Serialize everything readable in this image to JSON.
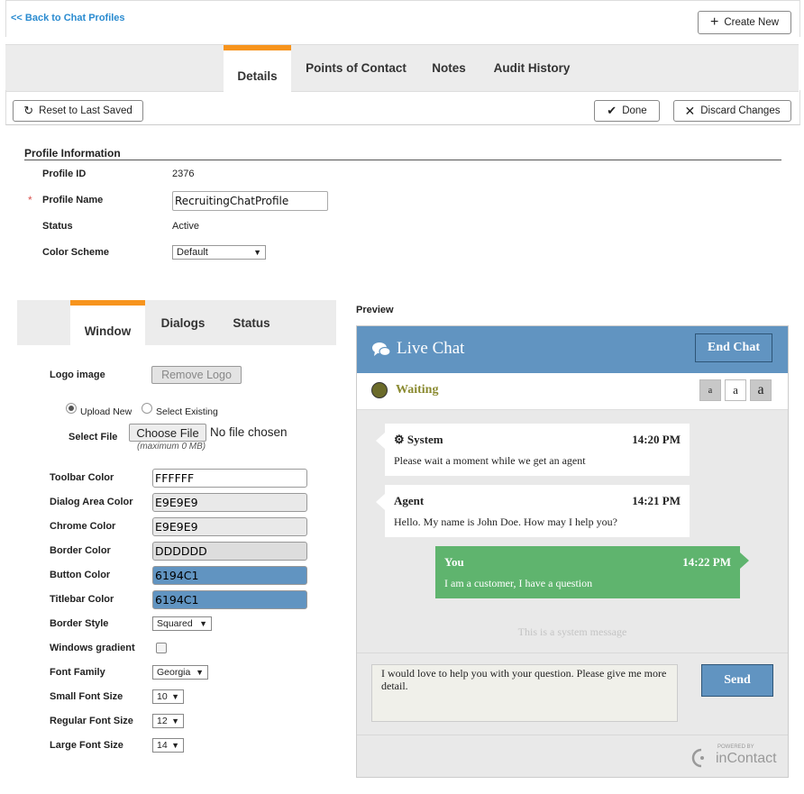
{
  "nav": {
    "back_label": "<< Back to Chat Profiles",
    "create_new_label": "Create New"
  },
  "tabs": [
    {
      "label": "Details",
      "active": true
    },
    {
      "label": "Points of Contact",
      "active": false
    },
    {
      "label": "Notes",
      "active": false
    },
    {
      "label": "Audit History",
      "active": false
    }
  ],
  "toolbar": {
    "reset_label": "Reset to Last Saved",
    "done_label": "Done",
    "discard_label": "Discard Changes"
  },
  "profile": {
    "section_title": "Profile Information",
    "id_label": "Profile ID",
    "id_value": "2376",
    "required_mark": "*",
    "name_label": "Profile Name",
    "name_value": "RecruitingChatProfile",
    "status_label": "Status",
    "status_value": "Active",
    "color_label": "Color Scheme",
    "color_value": "Default"
  },
  "subtabs": [
    {
      "label": "Window",
      "active": true
    },
    {
      "label": "Dialogs",
      "active": false
    },
    {
      "label": "Status",
      "active": false
    }
  ],
  "window_settings": {
    "logo_label": "Logo image",
    "remove_logo_label": "Remove Logo",
    "upload_new_label": "Upload New",
    "select_existing_label": "Select Existing",
    "select_file_label": "Select File",
    "choose_file_label": "Choose File",
    "no_file_label": "No file chosen",
    "max_size_note": "(maximum 0 MB)",
    "colors": [
      {
        "label": "Toolbar Color",
        "value": "FFFFFF",
        "bg": "#ffffff"
      },
      {
        "label": "Dialog Area Color",
        "value": "E9E9E9",
        "bg": "#e9e9e9"
      },
      {
        "label": "Chrome Color",
        "value": "E9E9E9",
        "bg": "#e9e9e9"
      },
      {
        "label": "Border Color",
        "value": "DDDDDD",
        "bg": "#dddddd"
      },
      {
        "label": "Button Color",
        "value": "6194C1",
        "bg": "#6194c1"
      },
      {
        "label": "Titlebar Color",
        "value": "6194C1",
        "bg": "#6194c1"
      }
    ],
    "border_style_label": "Border Style",
    "border_style_value": "Squared",
    "gradient_label": "Windows gradient",
    "gradient_checked": false,
    "font_family_label": "Font Family",
    "font_family_value": "Georgia",
    "small_font_label": "Small Font Size",
    "small_font_value": "10",
    "regular_font_label": "Regular Font Size",
    "regular_font_value": "12",
    "large_font_label": "Large Font Size",
    "large_font_value": "14"
  },
  "preview": {
    "label": "Preview",
    "title": "Live Chat",
    "end_chat_label": "End Chat",
    "status_text": "Waiting",
    "status_color": "#6b6b2a",
    "font_size_buttons": [
      "a",
      "a",
      "a"
    ],
    "messages": [
      {
        "sender": "System",
        "time": "14:20 PM",
        "text": "Please wait a moment while we get an agent"
      },
      {
        "sender": "Agent",
        "time": "14:21 PM",
        "text": "Hello. My name is John Doe. How may I help you?"
      },
      {
        "sender": "You",
        "time": "14:22 PM",
        "text": "I am a customer, I have a question"
      }
    ],
    "system_message": "This is a system message",
    "input_text": "I would love to help you with your question. Please give me more detail.",
    "send_label": "Send",
    "powered_by": "POWERED BY",
    "brand": "inContact",
    "accent": "#6194c1",
    "customer_bubble_color": "#5fb46e"
  }
}
